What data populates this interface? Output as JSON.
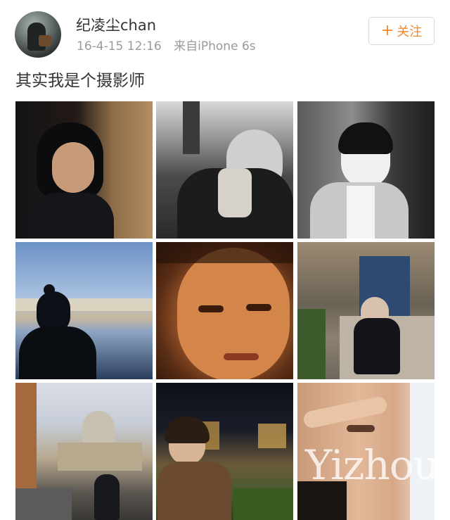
{
  "post": {
    "username": "纪凌尘chan",
    "timestamp": "16-4-15 12:16",
    "source": "来自iPhone 6s",
    "follow_button": {
      "icon": "+",
      "label": "关注"
    },
    "text": "其实我是个摄影师",
    "accent_color": "#f28a2e"
  },
  "watermark": {
    "text": "Yizhou"
  }
}
